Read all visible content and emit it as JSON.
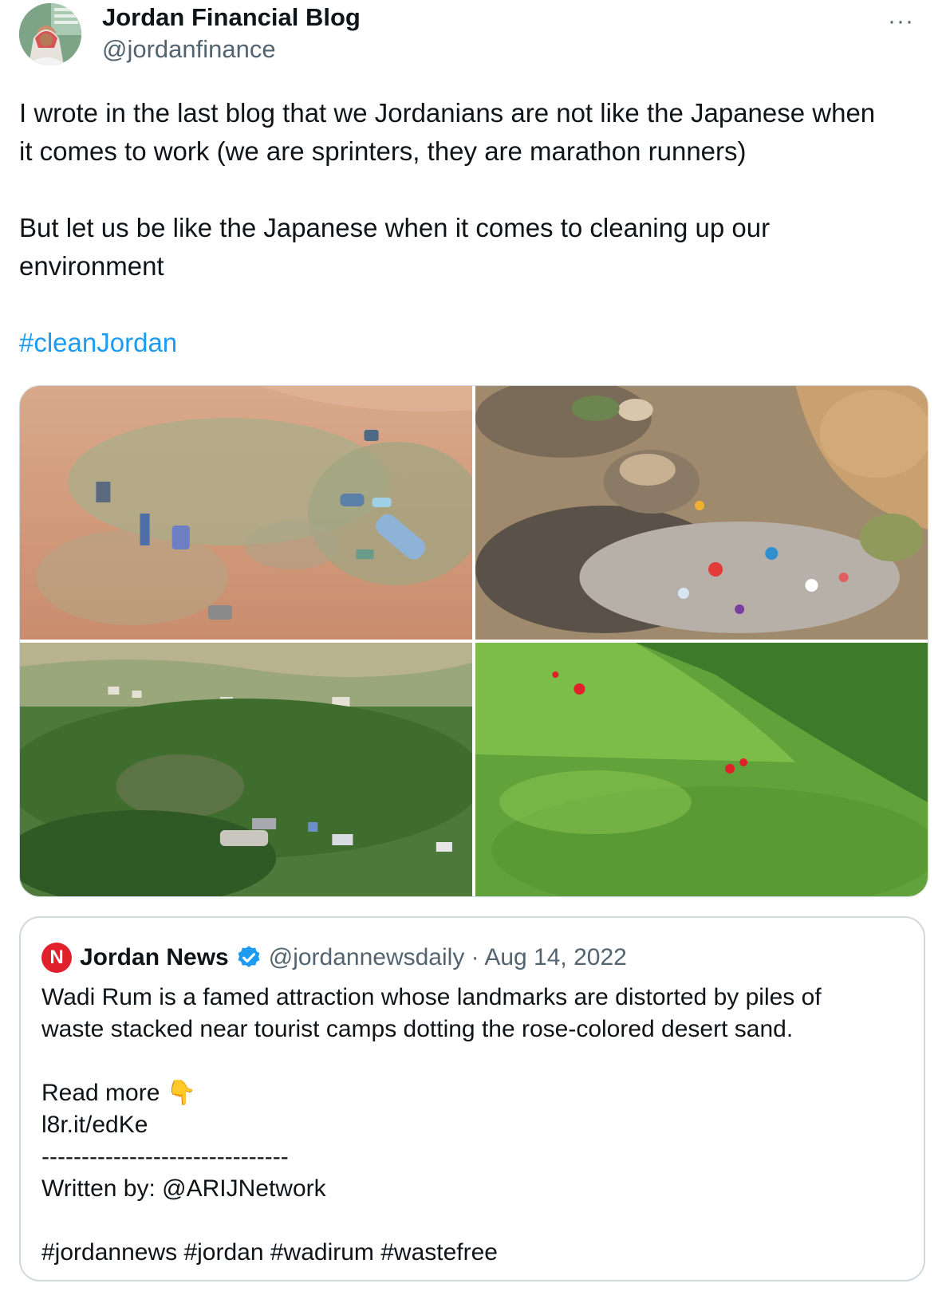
{
  "author": {
    "name": "Jordan Financial Blog",
    "handle": "@jordanfinance",
    "avatar_icon": "avatar-man-keffiyeh"
  },
  "more_icon": "···",
  "tweet": {
    "line1": "I wrote in the last blog that we Jordanians are not like the Japanese when",
    "line2": "it comes to work (we are sprinters, they are marathon runners)",
    "line3": "But let us be like the Japanese when it comes to cleaning up our",
    "line4": "environment",
    "hashtag": "#cleanJordan"
  },
  "photos": [
    {
      "icon": "photo-desert-sand-litter"
    },
    {
      "icon": "photo-rocky-wadi-litter"
    },
    {
      "icon": "photo-green-hillside-litter"
    },
    {
      "icon": "photo-green-slope-poppies"
    }
  ],
  "quoted_tweet": {
    "logo_letter": "N",
    "name": "Jordan News",
    "verified_icon": "verified-badge-icon",
    "handle_and_date": "@jordannewsdaily · Aug 14, 2022",
    "line1": "Wadi Rum is a famed attraction whose landmarks are distorted by piles of",
    "line2": "waste stacked near tourist camps dotting the rose-colored desert sand.",
    "read_more": "Read more 👇",
    "link": "l8r.it/edKe",
    "divider": "-------------------------------",
    "written_by": "Written by: @ARIJNetwork",
    "hashtags": "#jordannews #jordan #wadirum #wastefree"
  },
  "colors": {
    "link_blue": "#1d9bf0",
    "text": "#0f1419",
    "secondary": "#536471",
    "border": "#cfd9de",
    "news_logo_red": "#e0202a"
  }
}
